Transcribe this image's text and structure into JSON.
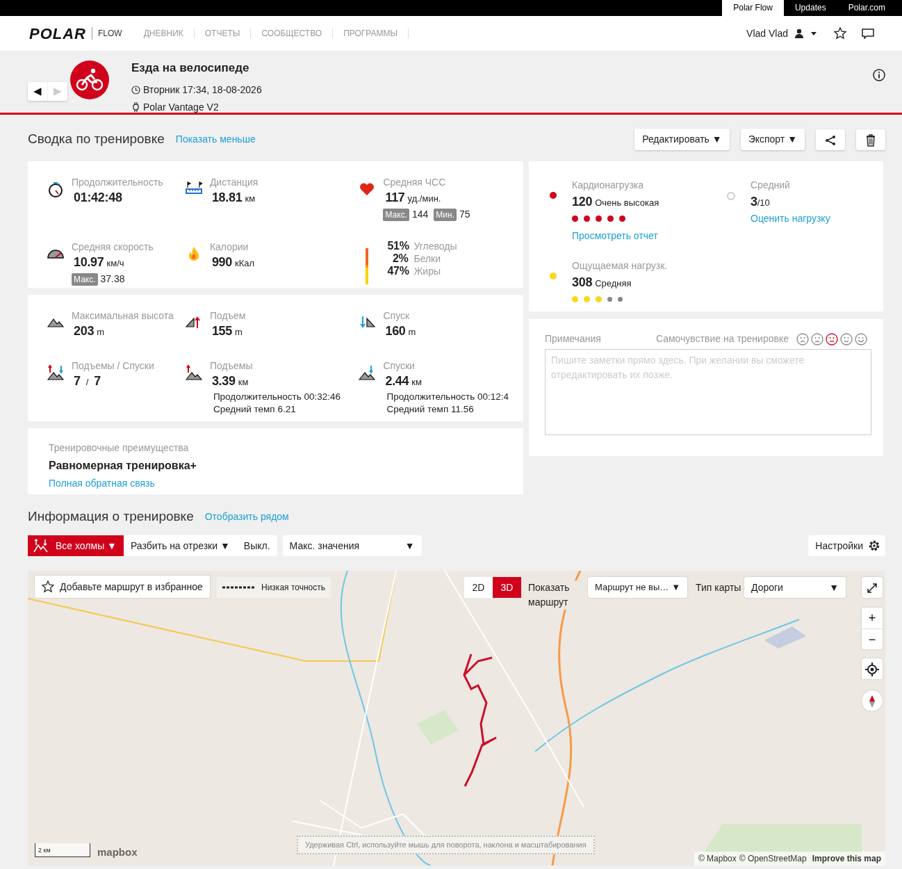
{
  "top_links": [
    {
      "label": "Polar Flow",
      "selected": true
    },
    {
      "label": "Updates",
      "selected": false
    },
    {
      "label": "Polar.com",
      "selected": false
    }
  ],
  "nav": {
    "brand": "POLAR",
    "product": "FLOW",
    "items": [
      "ДНЕВНИК",
      "ОТЧЕТЫ",
      "СООБЩЕСТВО",
      "ПРОГРАММЫ"
    ],
    "user": "Vlad Vlad"
  },
  "session": {
    "arrows": [
      {
        "glyph": "◀",
        "disabled": false
      },
      {
        "glyph": "▶",
        "disabled": true
      }
    ],
    "title": "Езда на велосипеде",
    "datetime": "Вторник 17:34, 18-08-2026",
    "device": "Polar Vantage V2"
  },
  "summary": {
    "title": "Сводка по тренировке",
    "toggle_link": "Показать меньше",
    "actions": [
      {
        "kind": "dropdown",
        "label": "Редактировать",
        "caret": "▼"
      },
      {
        "kind": "dropdown",
        "label": "Экспорт",
        "caret": "▼"
      },
      {
        "kind": "share"
      },
      {
        "kind": "delete"
      }
    ],
    "stats": [
      {
        "kind": "stopwatch",
        "label": "Продолжительность",
        "value": "01:42:48"
      },
      {
        "kind": "distance",
        "label": "Дистанция",
        "value": "18.81",
        "unit": "км"
      },
      {
        "kind": "heart",
        "label": "Средняя ЧСС",
        "value": "117",
        "unit": "уд./мин.",
        "extras": [
          {
            "badge": "Макс.",
            "value": "144"
          },
          {
            "badge": "Мин.",
            "value": "75"
          }
        ]
      },
      {
        "kind": "speed",
        "label": "Средняя скорость",
        "value": "10.97",
        "unit": "км/ч",
        "extras": [
          {
            "badge": "Макс.",
            "value": "37.38"
          }
        ]
      },
      {
        "kind": "flame",
        "label": "Калории",
        "value": "990",
        "unit": "кКал"
      },
      {
        "kind": "fuel",
        "items": [
          {
            "percent": "51%",
            "label": "Углеводы",
            "color": "#f26522"
          },
          {
            "percent": "2%",
            "label": "Белки",
            "color": "#f7941d"
          },
          {
            "percent": "47%",
            "label": "Жиры",
            "color": "#ffd200"
          }
        ]
      }
    ],
    "elevation": [
      {
        "kind": "mountain",
        "label": "Максимальная высота",
        "value": "203",
        "unit": "m"
      },
      {
        "kind": "ascent",
        "label": "Подъем",
        "value": "155",
        "unit": "m"
      },
      {
        "kind": "descent",
        "label": "Спуск",
        "value": "160",
        "unit": "m"
      },
      {
        "kind": "updown",
        "label": "Подъемы / Спуски",
        "value": "7",
        "separator": "/",
        "value2": "7"
      },
      {
        "kind": "uphill",
        "label": "Подъемы",
        "value": "3.39",
        "unit": "км",
        "lines": [
          "Продолжительность 00:32:46",
          "Средний темп 6.21"
        ]
      },
      {
        "kind": "downhill",
        "label": "Спуски",
        "value": "2.44",
        "unit": "км",
        "lines": [
          "Продолжительность 00:12:4",
          "Средний темп 11.56"
        ]
      }
    ],
    "benefit": {
      "label": "Тренировочные преимущества",
      "value": "Равномерная тренировка+",
      "link": "Полная обратная связь"
    },
    "loads": [
      {
        "label": "Кардионагрузка",
        "value": "120",
        "desc": "Очень высокая",
        "color": "#d0021b",
        "stars": 5,
        "link": "Просмотреть отчет"
      },
      {
        "label": "Ощущаемая нагрузк.",
        "value": "308",
        "desc": "Средняя",
        "color": "#f8d81c",
        "stars": 3
      }
    ],
    "rating": {
      "label": "Средний",
      "value": "3",
      "scale": "/10",
      "link": "Оценить нагрузку"
    },
    "notes": {
      "label": "Примечания",
      "feeling_label": "Самочувствие на тренировке",
      "feelings": [
        {
          "selected": false
        },
        {
          "selected": false
        },
        {
          "selected": true
        },
        {
          "selected": false
        },
        {
          "selected": false
        }
      ],
      "placeholder": "Пишите заметки прямо здесь. При желании вы сможете отредактировать их позже."
    }
  },
  "info": {
    "title": "Информация о тренировке",
    "link": "Отобразить рядом",
    "toolbar": {
      "hills": {
        "label": "Все холмы",
        "caret": "▼",
        "selected": true
      },
      "split": {
        "label": "Разбить на отрезки",
        "caret": "▼"
      },
      "off": "Выкл.",
      "select": {
        "value": "Макс. значения",
        "caret": "▼"
      },
      "settings": "Настройки"
    },
    "map": {
      "kind": "picture",
      "favorite": "Добавьте маршрут в избранное",
      "accuracy": "Низкая точность",
      "views": [
        {
          "label": "2D",
          "selected": false
        },
        {
          "label": "3D",
          "selected": true
        }
      ],
      "route_label": "Показать маршрут",
      "route_select": {
        "value": "Маршрут не вы…",
        "caret": "▼"
      },
      "type_label": "Тип карты",
      "type_select": {
        "value": "Дороги",
        "caret": "▼"
      },
      "zoom": [
        "+",
        "−"
      ],
      "scale": "2 км",
      "logo": "mapbox",
      "hint": "Удерживая Ctrl, используйте мышь для поворота, наклона и масштабирования",
      "attribution": [
        "© Mapbox",
        "© OpenStreetMap",
        "Improve this map"
      ]
    }
  }
}
